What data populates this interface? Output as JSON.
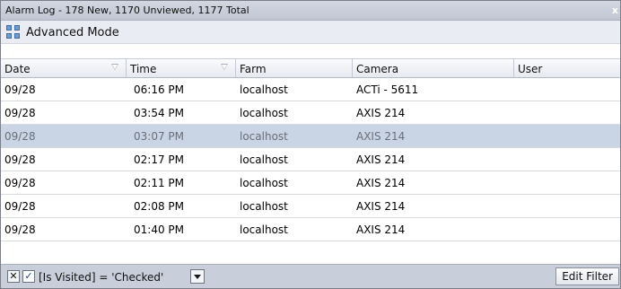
{
  "window": {
    "title": "Alarm Log - 178 New, 1170 Unviewed, 1177 Total",
    "close_glyph": "x"
  },
  "toolbar": {
    "mode_label": "Advanced Mode",
    "mode_icon": "expand-grid-icon"
  },
  "columns": [
    {
      "label": "Date",
      "filter": true
    },
    {
      "label": "Time",
      "filter": true
    },
    {
      "label": "Farm",
      "filter": false
    },
    {
      "label": "Camera",
      "filter": false
    },
    {
      "label": "User",
      "filter": false
    }
  ],
  "rows": [
    {
      "date": "09/28",
      "time": "06:16 PM",
      "farm": "localhost",
      "camera": "ACTi - 5611",
      "user": ""
    },
    {
      "date": "09/28",
      "time": "03:54 PM",
      "farm": "localhost",
      "camera": "AXIS 214",
      "user": ""
    },
    {
      "date": "09/28",
      "time": "03:07 PM",
      "farm": "localhost",
      "camera": "AXIS 214",
      "user": "",
      "selected": true
    },
    {
      "date": "09/28",
      "time": "02:17 PM",
      "farm": "localhost",
      "camera": "AXIS 214",
      "user": ""
    },
    {
      "date": "09/28",
      "time": "02:11 PM",
      "farm": "localhost",
      "camera": "AXIS 214",
      "user": ""
    },
    {
      "date": "09/28",
      "time": "02:08 PM",
      "farm": "localhost",
      "camera": "AXIS 214",
      "user": ""
    },
    {
      "date": "09/28",
      "time": "01:40 PM",
      "farm": "localhost",
      "camera": "AXIS 214",
      "user": ""
    }
  ],
  "statusbar": {
    "clear_glyph": "✕",
    "checkbox_checked": true,
    "checkbox_glyph": "✓",
    "filter_text": "[Is Visited] = 'Checked'",
    "edit_filter_label": "Edit Filter"
  },
  "colors": {
    "selected_row": "#c9d5e4",
    "title_bar": "#c8cdd8",
    "status_bar": "#c8cfdb"
  }
}
